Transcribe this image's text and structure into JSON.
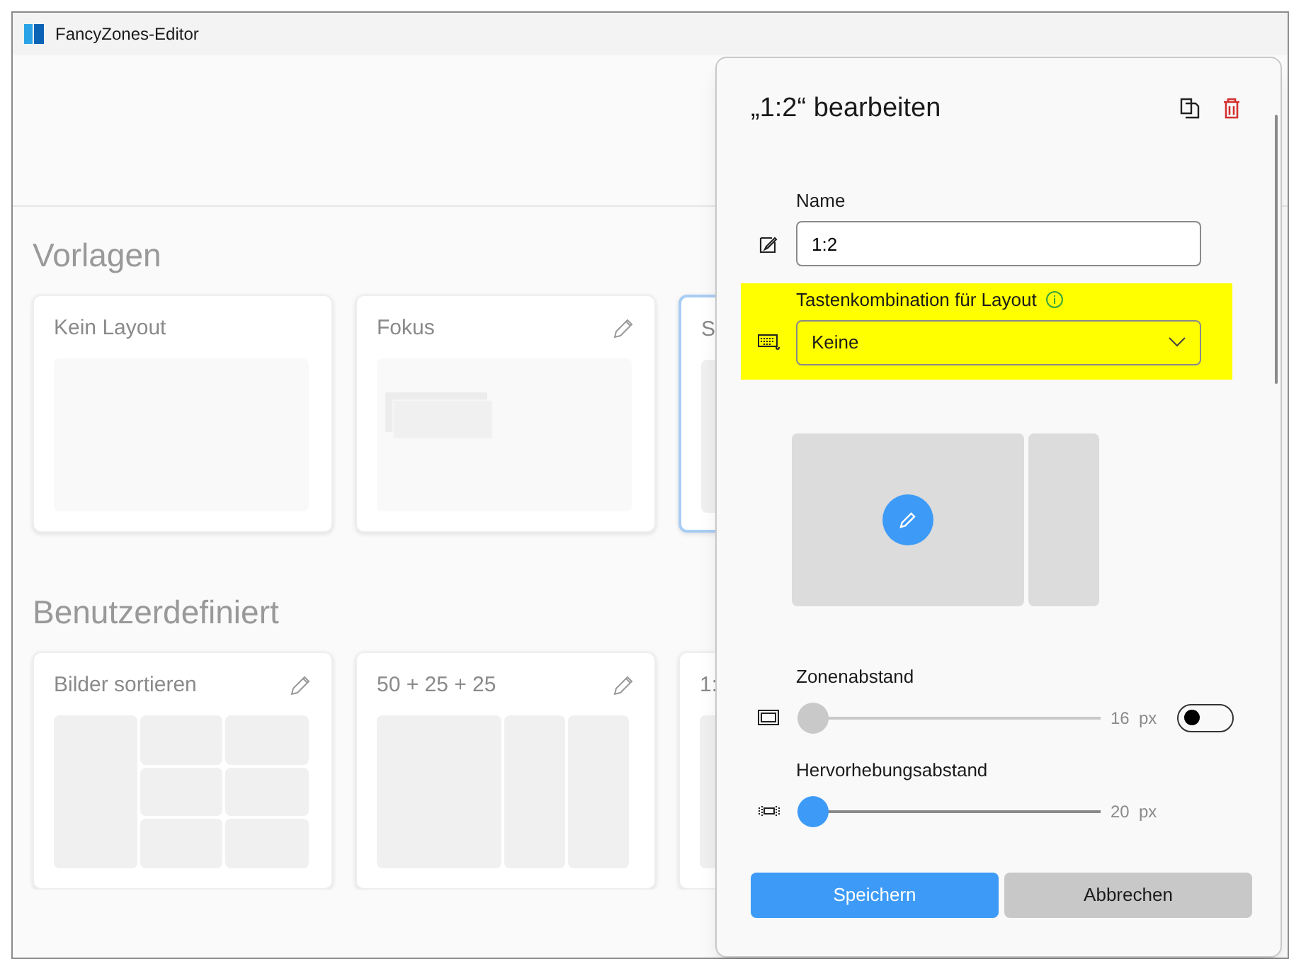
{
  "window": {
    "title": "FancyZones-Editor"
  },
  "sections": [
    {
      "title": "Vorlagen",
      "cards": [
        {
          "title": "Kein Layout",
          "editable": false,
          "selected": false,
          "preview": {
            "kind": "blank"
          }
        },
        {
          "title": "Fokus",
          "editable": true,
          "selected": false,
          "preview": {
            "kind": "focus"
          }
        },
        {
          "title": "S",
          "editable": false,
          "selected": true,
          "preview": {
            "kind": "columns"
          }
        }
      ]
    },
    {
      "title": "Benutzerdefiniert",
      "cards": [
        {
          "title": "Bilder sortieren",
          "editable": true,
          "selected": false,
          "preview": {
            "kind": "grid"
          }
        },
        {
          "title": "50 + 25 + 25",
          "editable": true,
          "selected": false,
          "preview": {
            "kind": "columns"
          }
        },
        {
          "title": "1:",
          "editable": false,
          "selected": false,
          "preview": {
            "kind": "columns"
          }
        }
      ]
    }
  ],
  "dialog": {
    "title": "„1:2“ bearbeiten",
    "name_field": {
      "label": "Name",
      "value": "1:2"
    },
    "hotkey_field": {
      "label": "Tastenkombination für Layout",
      "value": "Keine",
      "highlighted": true
    },
    "sliders": [
      {
        "label": "Zonenabstand",
        "value": "16",
        "unit": "px",
        "level": 0,
        "disabled": true,
        "toggle": {
          "on": false
        }
      },
      {
        "label": "Hervorhebungsabstand",
        "value": "20",
        "unit": "px",
        "level": 0,
        "disabled": false
      }
    ],
    "buttons": [
      {
        "label": "Speichern",
        "kind": "primary"
      },
      {
        "label": "Abbrechen",
        "kind": "secondary"
      }
    ]
  }
}
